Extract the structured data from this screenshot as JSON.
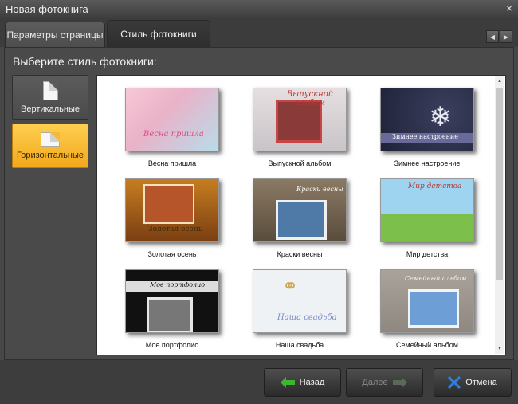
{
  "window": {
    "title": "Новая фотокнига",
    "close_glyph": "×"
  },
  "tabs": [
    {
      "label": "Параметры страницы"
    },
    {
      "label": "Стиль фотокниги"
    }
  ],
  "tab_nav": {
    "prev_glyph": "◀",
    "next_glyph": "▶"
  },
  "prompt": "Выберите стиль фотокниги:",
  "orientation": [
    {
      "label": "Вертикальные",
      "selected": false
    },
    {
      "label": "Горизонтальные",
      "selected": true
    }
  ],
  "styles": [
    {
      "caption": "Весна пришла",
      "overlay": "Весна пришла"
    },
    {
      "caption": "Выпускной альбом",
      "overlay": "Выпускной альбом"
    },
    {
      "caption": "Зимнее настроение",
      "overlay": "Зимнее настроение"
    },
    {
      "caption": "Золотая осень",
      "overlay": "Золотая осень"
    },
    {
      "caption": "Краски весны",
      "overlay": "Краски весны"
    },
    {
      "caption": "Мир детства",
      "overlay": "Мир детства"
    },
    {
      "caption": "Мое портфолио",
      "overlay": "Мое портфолио"
    },
    {
      "caption": "Наша свадьба",
      "overlay": "Наша свадьба"
    },
    {
      "caption": "Семейный альбом",
      "overlay": "Семейный альбом"
    }
  ],
  "scrollbar": {
    "up_glyph": "▲",
    "down_glyph": "▼"
  },
  "buttons": {
    "back": {
      "label": "Назад",
      "icon": "arrow-left-icon"
    },
    "next": {
      "label": "Далее",
      "icon": "arrow-right-icon",
      "enabled": false
    },
    "cancel": {
      "label": "Отмена",
      "icon": "close-icon"
    }
  },
  "colors": {
    "accent": "#f2a81c",
    "back_arrow": "#3cb82e",
    "cancel_x": "#2a7fe0"
  }
}
